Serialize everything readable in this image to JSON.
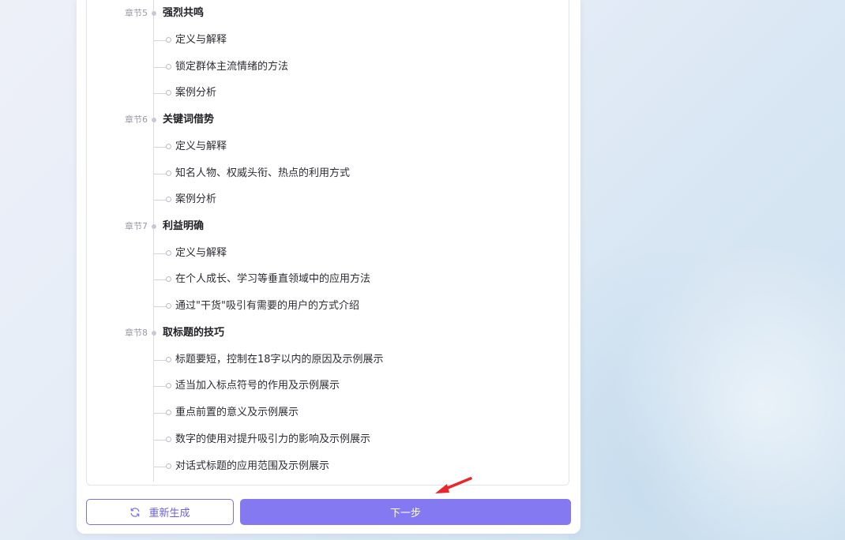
{
  "outline": [
    {
      "chapter_label": "章节5",
      "title": "强烈共鸣",
      "items": [
        "定义与解释",
        "锁定群体主流情绪的方法",
        "案例分析"
      ]
    },
    {
      "chapter_label": "章节6",
      "title": "关键词借势",
      "items": [
        "定义与解释",
        "知名人物、权威头衔、热点的利用方式",
        "案例分析"
      ]
    },
    {
      "chapter_label": "章节7",
      "title": "利益明确",
      "items": [
        "定义与解释",
        "在个人成长、学习等垂直领域中的应用方法",
        "通过\"干货\"吸引有需要的用户的方式介绍"
      ]
    },
    {
      "chapter_label": "章节8",
      "title": "取标题的技巧",
      "items": [
        "标题要短，控制在18字以内的原因及示例展示",
        "适当加入标点符号的作用及示例展示",
        "重点前置的意义及示例展示",
        "数字的使用对提升吸引力的影响及示例展示",
        "对话式标题的应用范围及示例展示"
      ]
    }
  ],
  "actions": {
    "regenerate_label": "重新生成",
    "next_label": "下一步",
    "regenerate_icon": "refresh-icon"
  },
  "colors": {
    "accent": "#8479f0",
    "accent_border": "#7b72e8",
    "annotation_arrow": "#e8262b"
  }
}
